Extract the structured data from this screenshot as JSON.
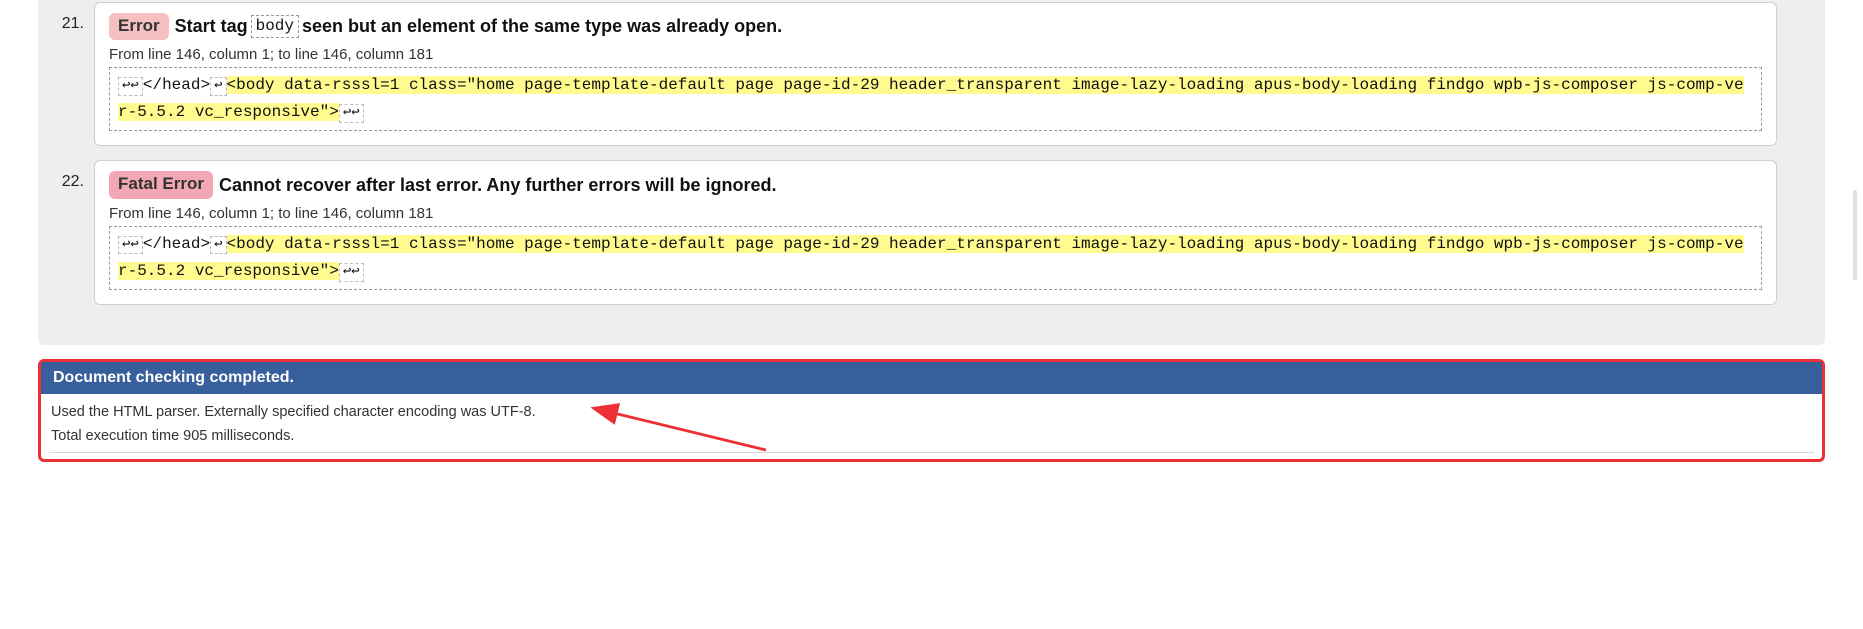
{
  "errors": [
    {
      "number": "21.",
      "badgeType": "error",
      "badgeLabel": "Error",
      "titlePre": "Start tag",
      "titleTag": "body",
      "titlePost": "seen but an element of the same type was already open.",
      "location": "From line 146, column 1; to line 146, column 181",
      "codePreNL": "↩↩",
      "codePre": "</head>",
      "codeMidNL": "↩",
      "codeHighlight": "<body data-rsssl=1 class=\"home page-template-default page page-id-29 header_transparent image-lazy-loading apus-body-loading findgo wpb-js-composer js-comp-ver-5.5.2 vc_responsive\">",
      "codePostNL": "↩↩"
    },
    {
      "number": "22.",
      "badgeType": "fatal",
      "badgeLabel": "Fatal Error",
      "titlePre": "",
      "titleTag": "",
      "titlePost": "Cannot recover after last error. Any further errors will be ignored.",
      "location": "From line 146, column 1; to line 146, column 181",
      "codePreNL": "↩↩",
      "codePre": "</head>",
      "codeMidNL": "↩",
      "codeHighlight": "<body data-rsssl=1 class=\"home page-template-default page page-id-29 header_transparent image-lazy-loading apus-body-loading findgo wpb-js-composer js-comp-ver-5.5.2 vc_responsive\">",
      "codePostNL": "↩↩"
    }
  ],
  "completion": {
    "heading": "Document checking completed.",
    "parserLine": "Used the HTML parser. Externally specified character encoding was UTF-8.",
    "timingLine": "Total execution time 905 milliseconds."
  }
}
